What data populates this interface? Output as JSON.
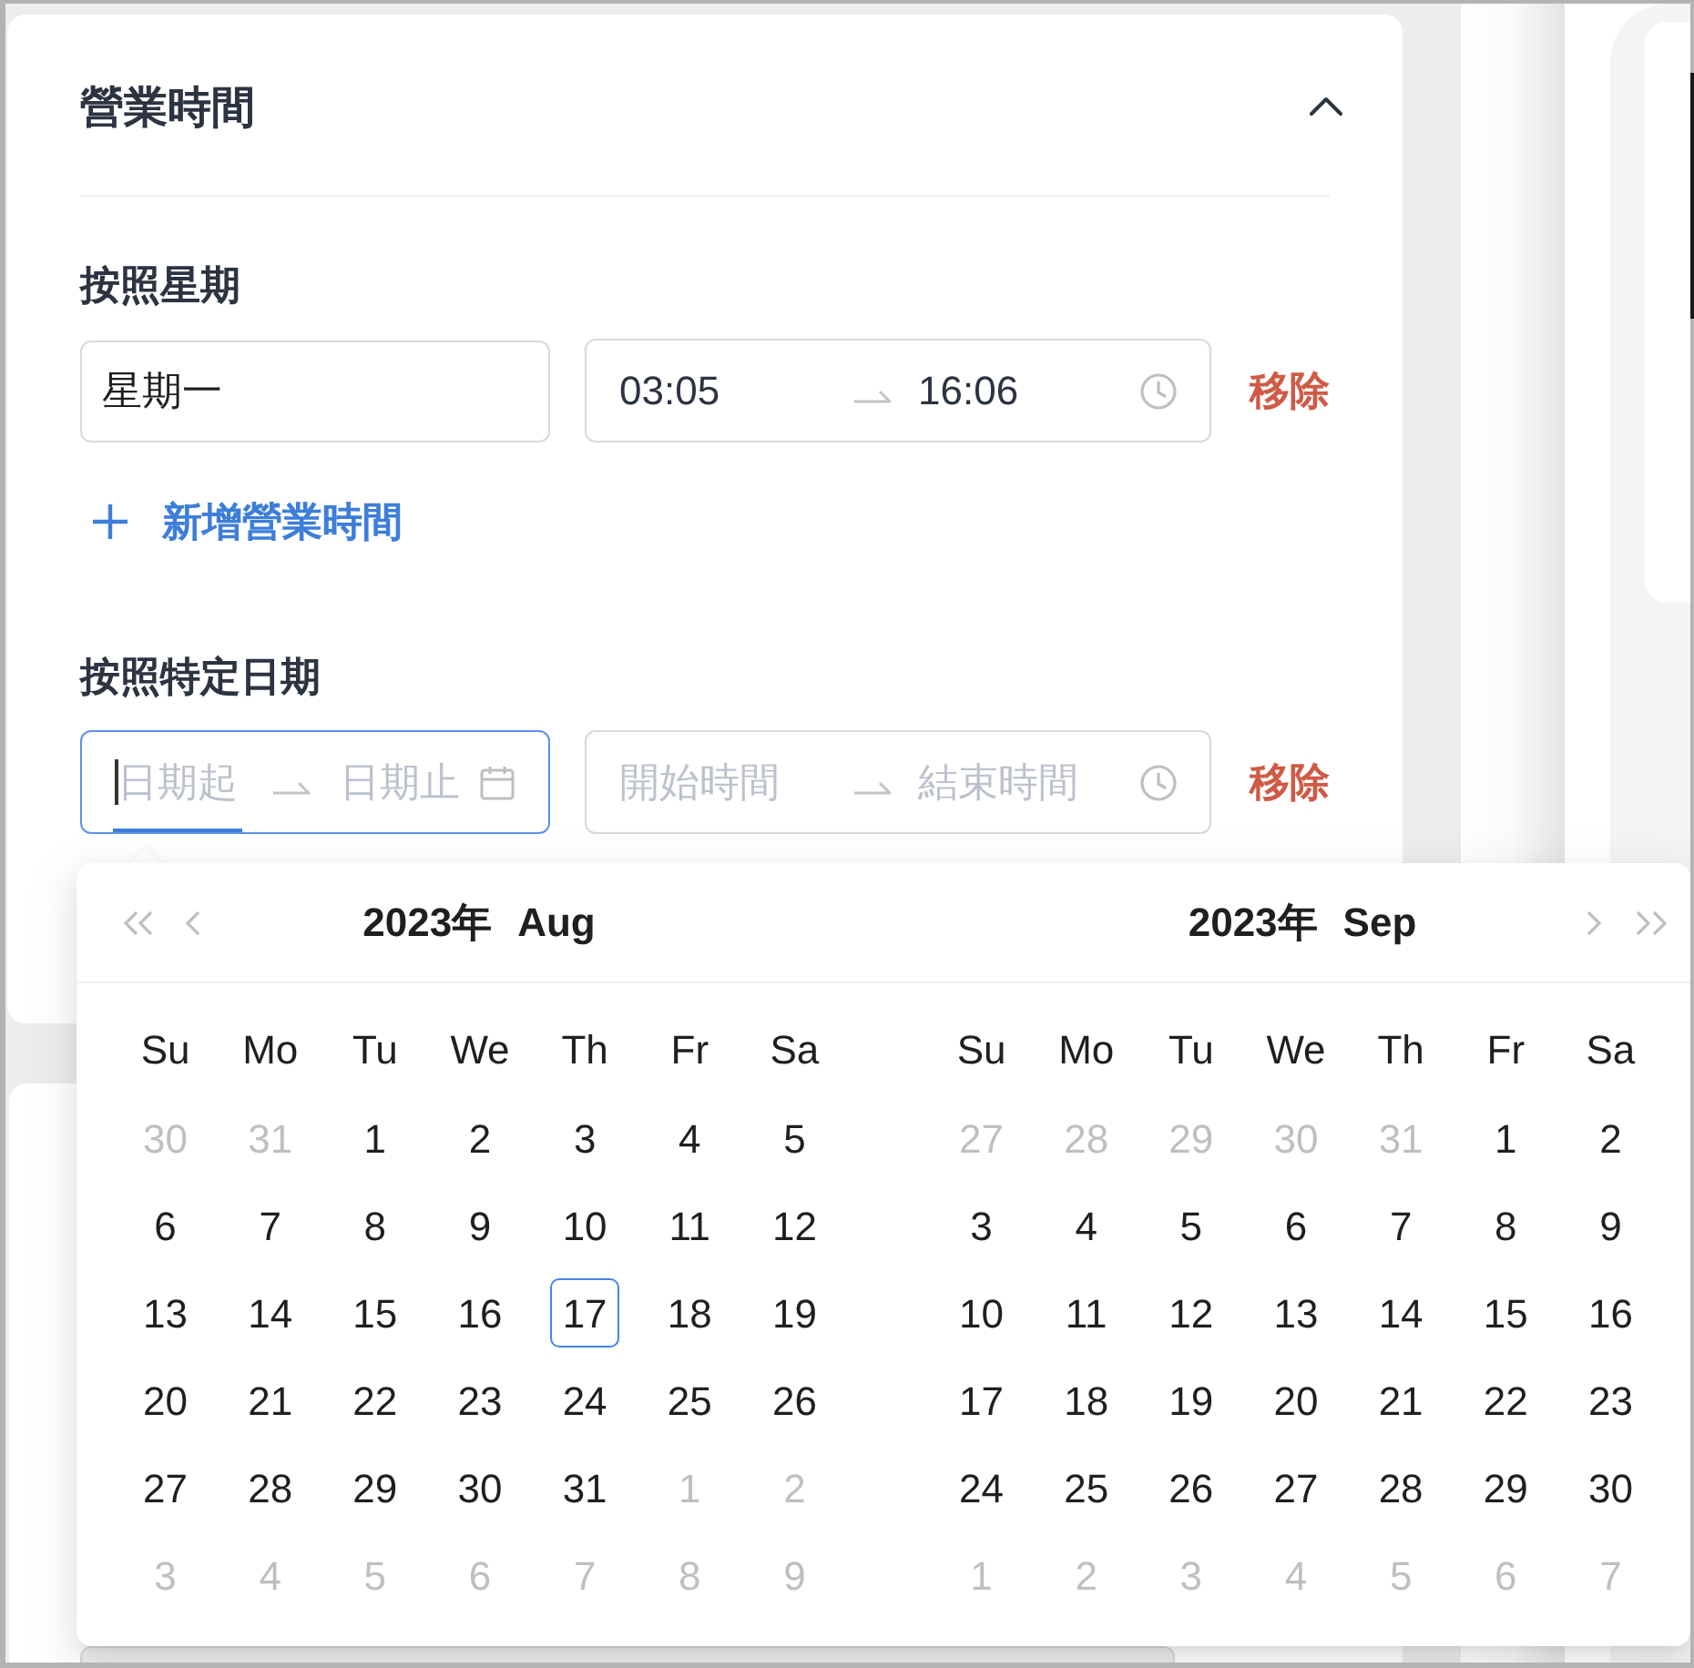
{
  "section": {
    "title": "營業時間",
    "expanded": true
  },
  "weekly": {
    "label": "按照星期",
    "rows": [
      {
        "day": "星期一",
        "time_range": {
          "start": "03:05",
          "end": "16:06"
        },
        "remove": "移除"
      }
    ],
    "add_button": "新增營業時間"
  },
  "specific_dates": {
    "label": "按照特定日期",
    "rows": [
      {
        "date_range": {
          "start_placeholder": "日期起",
          "end_placeholder": "日期止",
          "focused": true
        },
        "time_range": {
          "start_placeholder": "開始時間",
          "end_placeholder": "結束時間"
        },
        "remove": "移除"
      }
    ]
  },
  "date_picker": {
    "panels": [
      {
        "year": "2023年",
        "month": "Aug",
        "weekdays": [
          "Su",
          "Mo",
          "Tu",
          "We",
          "Th",
          "Fr",
          "Sa"
        ],
        "days": [
          {
            "label": "30",
            "in_month": false,
            "today": false
          },
          {
            "label": "31",
            "in_month": false,
            "today": false
          },
          {
            "label": "1",
            "in_month": true,
            "today": false
          },
          {
            "label": "2",
            "in_month": true,
            "today": false
          },
          {
            "label": "3",
            "in_month": true,
            "today": false
          },
          {
            "label": "4",
            "in_month": true,
            "today": false
          },
          {
            "label": "5",
            "in_month": true,
            "today": false
          },
          {
            "label": "6",
            "in_month": true,
            "today": false
          },
          {
            "label": "7",
            "in_month": true,
            "today": false
          },
          {
            "label": "8",
            "in_month": true,
            "today": false
          },
          {
            "label": "9",
            "in_month": true,
            "today": false
          },
          {
            "label": "10",
            "in_month": true,
            "today": false
          },
          {
            "label": "11",
            "in_month": true,
            "today": false
          },
          {
            "label": "12",
            "in_month": true,
            "today": false
          },
          {
            "label": "13",
            "in_month": true,
            "today": false
          },
          {
            "label": "14",
            "in_month": true,
            "today": false
          },
          {
            "label": "15",
            "in_month": true,
            "today": false
          },
          {
            "label": "16",
            "in_month": true,
            "today": false
          },
          {
            "label": "17",
            "in_month": true,
            "today": true
          },
          {
            "label": "18",
            "in_month": true,
            "today": false
          },
          {
            "label": "19",
            "in_month": true,
            "today": false
          },
          {
            "label": "20",
            "in_month": true,
            "today": false
          },
          {
            "label": "21",
            "in_month": true,
            "today": false
          },
          {
            "label": "22",
            "in_month": true,
            "today": false
          },
          {
            "label": "23",
            "in_month": true,
            "today": false
          },
          {
            "label": "24",
            "in_month": true,
            "today": false
          },
          {
            "label": "25",
            "in_month": true,
            "today": false
          },
          {
            "label": "26",
            "in_month": true,
            "today": false
          },
          {
            "label": "27",
            "in_month": true,
            "today": false
          },
          {
            "label": "28",
            "in_month": true,
            "today": false
          },
          {
            "label": "29",
            "in_month": true,
            "today": false
          },
          {
            "label": "30",
            "in_month": true,
            "today": false
          },
          {
            "label": "31",
            "in_month": true,
            "today": false
          },
          {
            "label": "1",
            "in_month": false,
            "today": false
          },
          {
            "label": "2",
            "in_month": false,
            "today": false
          },
          {
            "label": "3",
            "in_month": false,
            "today": false
          },
          {
            "label": "4",
            "in_month": false,
            "today": false
          },
          {
            "label": "5",
            "in_month": false,
            "today": false
          },
          {
            "label": "6",
            "in_month": false,
            "today": false
          },
          {
            "label": "7",
            "in_month": false,
            "today": false
          },
          {
            "label": "8",
            "in_month": false,
            "today": false
          },
          {
            "label": "9",
            "in_month": false,
            "today": false
          }
        ]
      },
      {
        "year": "2023年",
        "month": "Sep",
        "weekdays": [
          "Su",
          "Mo",
          "Tu",
          "We",
          "Th",
          "Fr",
          "Sa"
        ],
        "days": [
          {
            "label": "27",
            "in_month": false,
            "today": false
          },
          {
            "label": "28",
            "in_month": false,
            "today": false
          },
          {
            "label": "29",
            "in_month": false,
            "today": false
          },
          {
            "label": "30",
            "in_month": false,
            "today": false
          },
          {
            "label": "31",
            "in_month": false,
            "today": false
          },
          {
            "label": "1",
            "in_month": true,
            "today": false
          },
          {
            "label": "2",
            "in_month": true,
            "today": false
          },
          {
            "label": "3",
            "in_month": true,
            "today": false
          },
          {
            "label": "4",
            "in_month": true,
            "today": false
          },
          {
            "label": "5",
            "in_month": true,
            "today": false
          },
          {
            "label": "6",
            "in_month": true,
            "today": false
          },
          {
            "label": "7",
            "in_month": true,
            "today": false
          },
          {
            "label": "8",
            "in_month": true,
            "today": false
          },
          {
            "label": "9",
            "in_month": true,
            "today": false
          },
          {
            "label": "10",
            "in_month": true,
            "today": false
          },
          {
            "label": "11",
            "in_month": true,
            "today": false
          },
          {
            "label": "12",
            "in_month": true,
            "today": false
          },
          {
            "label": "13",
            "in_month": true,
            "today": false
          },
          {
            "label": "14",
            "in_month": true,
            "today": false
          },
          {
            "label": "15",
            "in_month": true,
            "today": false
          },
          {
            "label": "16",
            "in_month": true,
            "today": false
          },
          {
            "label": "17",
            "in_month": true,
            "today": false
          },
          {
            "label": "18",
            "in_month": true,
            "today": false
          },
          {
            "label": "19",
            "in_month": true,
            "today": false
          },
          {
            "label": "20",
            "in_month": true,
            "today": false
          },
          {
            "label": "21",
            "in_month": true,
            "today": false
          },
          {
            "label": "22",
            "in_month": true,
            "today": false
          },
          {
            "label": "23",
            "in_month": true,
            "today": false
          },
          {
            "label": "24",
            "in_month": true,
            "today": false
          },
          {
            "label": "25",
            "in_month": true,
            "today": false
          },
          {
            "label": "26",
            "in_month": true,
            "today": false
          },
          {
            "label": "27",
            "in_month": true,
            "today": false
          },
          {
            "label": "28",
            "in_month": true,
            "today": false
          },
          {
            "label": "29",
            "in_month": true,
            "today": false
          },
          {
            "label": "30",
            "in_month": true,
            "today": false
          },
          {
            "label": "1",
            "in_month": false,
            "today": false
          },
          {
            "label": "2",
            "in_month": false,
            "today": false
          },
          {
            "label": "3",
            "in_month": false,
            "today": false
          },
          {
            "label": "4",
            "in_month": false,
            "today": false
          },
          {
            "label": "5",
            "in_month": false,
            "today": false
          },
          {
            "label": "6",
            "in_month": false,
            "today": false
          },
          {
            "label": "7",
            "in_month": false,
            "today": false
          }
        ]
      }
    ]
  }
}
